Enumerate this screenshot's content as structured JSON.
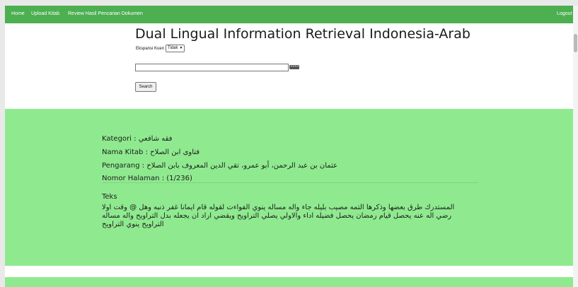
{
  "nav": {
    "home": "Home",
    "upload": "Upload Kitab",
    "review": "Review Hasil Pencarian Dokumen",
    "logout": "Logout"
  },
  "page": {
    "title": "Dual Lingual Information Retrieval Indonesia-Arab"
  },
  "search": {
    "expansion_label": "Ekspansi Kueri",
    "expansion_value": "Tidak",
    "query_value": "",
    "button_label": "Search",
    "keyboard_icon": "keyboard-icon"
  },
  "result": {
    "kategori_label": "Kategori :",
    "kategori_value": "فقه شافعي",
    "kitab_label": "Nama Kitab :",
    "kitab_value": "فتاوى ابن الصلاح",
    "pengarang_label": "Pengarang :",
    "pengarang_value": "عثمان بن عبد الرحمن، أبو عمرو، تقي الدين المعروف بابن الصلاح",
    "halaman_label": "Nomor Halaman :",
    "halaman_value": "(1/236)",
    "teks_label": "Teks",
    "teks_value": "المستدرك طرق بعضها وذكرها التمه مصيب بليله جاء واله مساله ينوي الفواءت لقوله قام ايمانا غفر ذنبه وهل @ وقت اولا رضي اله عنه يحصل قيام رمضان يحصل فضيله اداء والاولي يصلي التراويح ويقضي اراد ان يجعله بدل التراويح واله مساله التراويح ينوي التراويح"
  },
  "colors": {
    "navbar": "#4caf50",
    "result_band": "#8fea8f"
  }
}
